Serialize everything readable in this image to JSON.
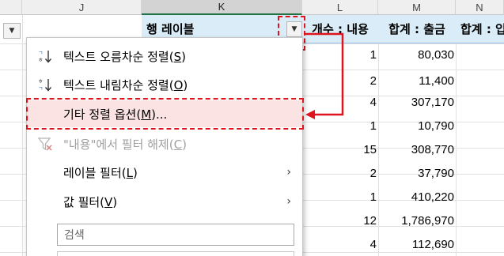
{
  "columns": {
    "j": "J",
    "k": "K",
    "l": "L",
    "m": "M",
    "n": "N"
  },
  "pivot_header": {
    "row_label": "행 레이블",
    "count_label": "개수 : 내용",
    "sum_out_label": "합계 : 출금",
    "sum_in_label": "합계 : 입"
  },
  "rows": [
    {
      "count": "1",
      "amount": "80,030"
    },
    {
      "count": "2",
      "amount": "11,400"
    },
    {
      "count": "4",
      "amount": "307,170"
    },
    {
      "count": "1",
      "amount": "10,790"
    },
    {
      "count": "15",
      "amount": "308,770"
    },
    {
      "count": "2",
      "amount": "37,790"
    },
    {
      "count": "1",
      "amount": "410,220"
    },
    {
      "count": "12",
      "amount": "1,786,970"
    },
    {
      "count": "4",
      "amount": "112,690"
    }
  ],
  "menu": {
    "sort_asc": {
      "text": "텍스트 오름차순 정렬(",
      "key": "S",
      "end": ")"
    },
    "sort_desc": {
      "text": "텍스트 내림차순 정렬(",
      "key": "O",
      "end": ")"
    },
    "more_sort": {
      "text": "기타 정렬 옵션(",
      "key": "M",
      "end": ")..."
    },
    "clear_filter": {
      "text": "\"내용\"에서 필터 해제(",
      "key": "C",
      "end": ")"
    },
    "label_filter": {
      "text": "레이블 필터(",
      "key": "L",
      "end": ")"
    },
    "value_filter": {
      "text": "값 필터(",
      "key": "V",
      "end": ")"
    },
    "search_placeholder": "검색"
  },
  "colors": {
    "annotation_red": "#e0141e",
    "pivot_header_bg": "#d9ecf7",
    "highlight_bg": "#fbe3e3"
  }
}
